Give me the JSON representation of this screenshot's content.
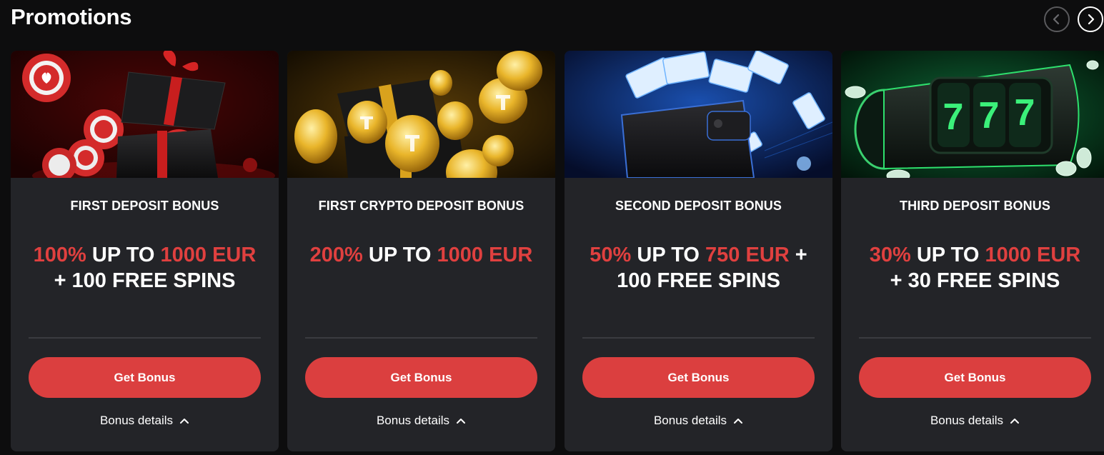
{
  "header": {
    "title": "Promotions",
    "prev_icon": "chevron-left-icon",
    "next_icon": "chevron-right-icon"
  },
  "colors": {
    "background": "#0d0d0e",
    "card": "#232428",
    "accent": "#db3f3f",
    "highlight_text": "#e0403f"
  },
  "cards": [
    {
      "title": "FIRST DEPOSIT BONUS",
      "offer": [
        {
          "text": "100%",
          "hl": true
        },
        {
          "text": " UP TO ",
          "hl": false
        },
        {
          "text": "1000 EUR",
          "hl": true
        },
        {
          "text": " + 100 FREE SPINS",
          "hl": false
        }
      ],
      "button": "Get Bonus",
      "details": "Bonus details",
      "image": "red-gift-box-casino-chips"
    },
    {
      "title": "FIRST CRYPTO DEPOSIT BONUS",
      "offer": [
        {
          "text": "200%",
          "hl": true
        },
        {
          "text": " UP TO ",
          "hl": false
        },
        {
          "text": "1000 EUR",
          "hl": true
        }
      ],
      "button": "Get Bonus",
      "details": "Bonus details",
      "image": "gold-crypto-coins-gift-box"
    },
    {
      "title": "SECOND DEPOSIT BONUS",
      "offer": [
        {
          "text": "50%",
          "hl": true
        },
        {
          "text": " UP TO ",
          "hl": false
        },
        {
          "text": "750 EUR",
          "hl": true
        },
        {
          "text": " + 100 FREE SPINS",
          "hl": false
        }
      ],
      "button": "Get Bonus",
      "details": "Bonus details",
      "image": "wallet-blue-banknotes"
    },
    {
      "title": "THIRD DEPOSIT BONUS",
      "offer": [
        {
          "text": "30%",
          "hl": true
        },
        {
          "text": " UP TO ",
          "hl": false
        },
        {
          "text": "1000 EUR",
          "hl": true
        },
        {
          "text": " + 30 FREE SPINS",
          "hl": false
        }
      ],
      "button": "Get Bonus",
      "details": "Bonus details",
      "image": "green-slot-machine-777",
      "reels": [
        "7",
        "7",
        "7"
      ]
    }
  ]
}
